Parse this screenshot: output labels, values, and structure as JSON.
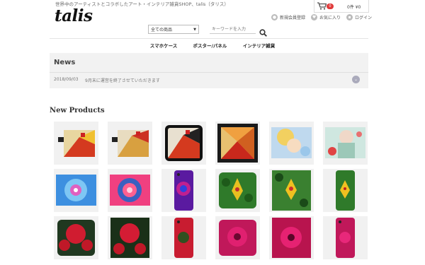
{
  "header": {
    "tagline": "世界中のアーティストとコラボしたアート・インテリア雑貨SHOP、talis（タリス）",
    "logo": "talis",
    "cart": {
      "count": "0",
      "total": "0件 ¥0"
    },
    "user_links": [
      {
        "label": "新規会員登録",
        "icon": "person-icon"
      },
      {
        "label": "お気に入り",
        "icon": "heart-icon"
      },
      {
        "label": "ログイン",
        "icon": "lock-icon"
      }
    ]
  },
  "search": {
    "category_selected": "全ての商品",
    "placeholder": "キーワードを入力"
  },
  "nav": {
    "items": [
      "スマホケース",
      "ポスター/パネル",
      "インテリア雑貨"
    ]
  },
  "news": {
    "title": "News",
    "items": [
      {
        "date": "2018/09/03",
        "text": "9月末に運営を終了させていただきます"
      }
    ]
  },
  "new_products": {
    "title": "New Products"
  },
  "colors": {
    "badge": "#e03a3a",
    "news_bg": "#f2f2f2",
    "tile_bg": "#f1f1f1"
  }
}
